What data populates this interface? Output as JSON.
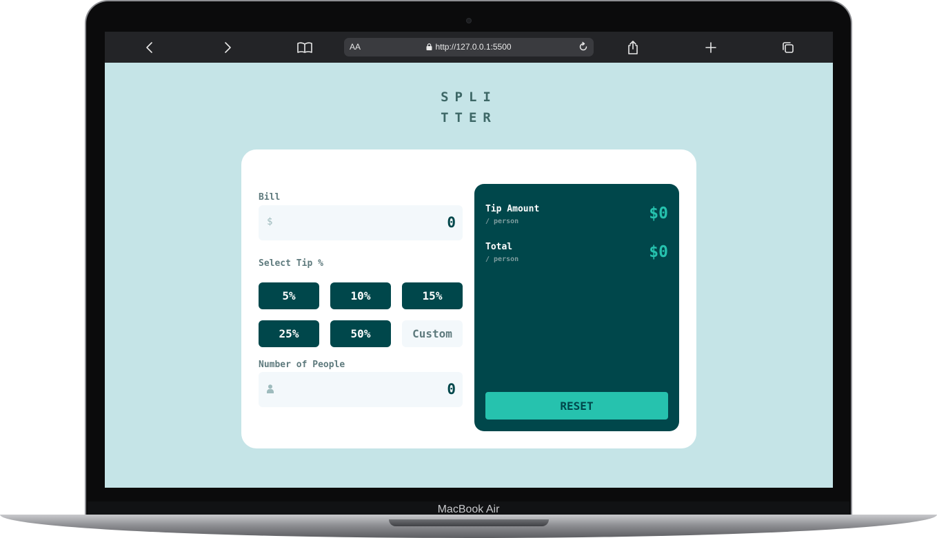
{
  "device": {
    "label": "MacBook Air"
  },
  "browser": {
    "reader_label": "AA",
    "url": "http://127.0.0.1:5500"
  },
  "app": {
    "logo_line1": "SPLI",
    "logo_line2": "TTER",
    "bill": {
      "label": "Bill",
      "currency_symbol": "$",
      "value": "0"
    },
    "tip": {
      "label": "Select Tip %",
      "options": [
        "5%",
        "10%",
        "15%",
        "25%",
        "50%"
      ],
      "custom_placeholder": "Custom"
    },
    "people": {
      "label": "Number of People",
      "value": "0"
    },
    "results": {
      "tip_amount_label": "Tip Amount",
      "tip_amount_sub": "/ person",
      "tip_amount_value": "$0",
      "total_label": "Total",
      "total_sub": "/ person",
      "total_value": "$0",
      "reset_label": "RESET"
    }
  },
  "colors": {
    "background": "#c5e4e7",
    "dark_cyan": "#00474b",
    "accent": "#26c2ae",
    "input_bg": "#f3f8fb"
  }
}
